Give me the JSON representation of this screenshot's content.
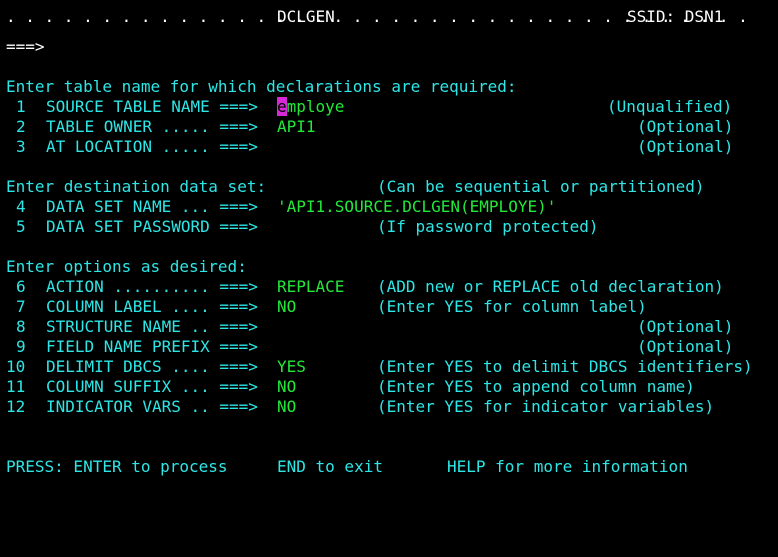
{
  "header": {
    "dots": ". . . . . . . . . . . . . . . . . . . . . . . . . . . . . . . . . . . . . . .",
    "title": "DCLGEN",
    "ssid": "SSID: DSN1"
  },
  "command_line": {
    "prompt": "===>",
    "value": ""
  },
  "sections": {
    "table": "Enter table name for which declarations are required:",
    "destination": "Enter destination data set:",
    "destination_hint": "(Can be sequential or partitioned)",
    "options": "Enter options as desired:"
  },
  "fields": [
    {
      "num": "1",
      "label": "SOURCE TABLE NAME ===>",
      "value_cursor": "e",
      "value_rest": "mploye",
      "hint": "(Unqualified)"
    },
    {
      "num": "2",
      "label": "TABLE OWNER ..... ===>",
      "value": "API1",
      "hint": "(Optional)"
    },
    {
      "num": "3",
      "label": "AT LOCATION ..... ===>",
      "value": "",
      "hint": "(Optional)"
    },
    {
      "num": "4",
      "label": "DATA SET NAME ... ===>",
      "value": "'API1.SOURCE.DCLGEN(EMPLOYE)'",
      "hint": ""
    },
    {
      "num": "5",
      "label": "DATA SET PASSWORD ===>",
      "value": "",
      "hint": "(If password protected)"
    },
    {
      "num": "6",
      "label": "ACTION .......... ===>",
      "value": "REPLACE",
      "hint": "(ADD new or REPLACE old declaration)"
    },
    {
      "num": "7",
      "label": "COLUMN LABEL .... ===>",
      "value": "NO",
      "hint": "(Enter YES for column label)"
    },
    {
      "num": "8",
      "label": "STRUCTURE NAME .. ===>",
      "value": "",
      "hint": "(Optional)"
    },
    {
      "num": "9",
      "label": "FIELD NAME PREFIX ===>",
      "value": "",
      "hint": "(Optional)"
    },
    {
      "num": "10",
      "label": "DELIMIT DBCS .... ===>",
      "value": "YES",
      "hint": "(Enter YES to delimit DBCS identifiers)"
    },
    {
      "num": "11",
      "label": "COLUMN SUFFIX ... ===>",
      "value": "NO",
      "hint": "(Enter YES to append column name)"
    },
    {
      "num": "12",
      "label": "INDICATOR VARS .. ===>",
      "value": "NO",
      "hint": "(Enter YES for indicator variables)"
    }
  ],
  "footer": {
    "press": "PRESS: ENTER to process",
    "end": "END to exit",
    "help": "HELP for more information"
  },
  "colors": {
    "background": "#000000",
    "protected_text": "#2ee6e6",
    "header_text": "#ffffff",
    "input_text": "#22e83a",
    "cursor": "#d62ad6"
  }
}
